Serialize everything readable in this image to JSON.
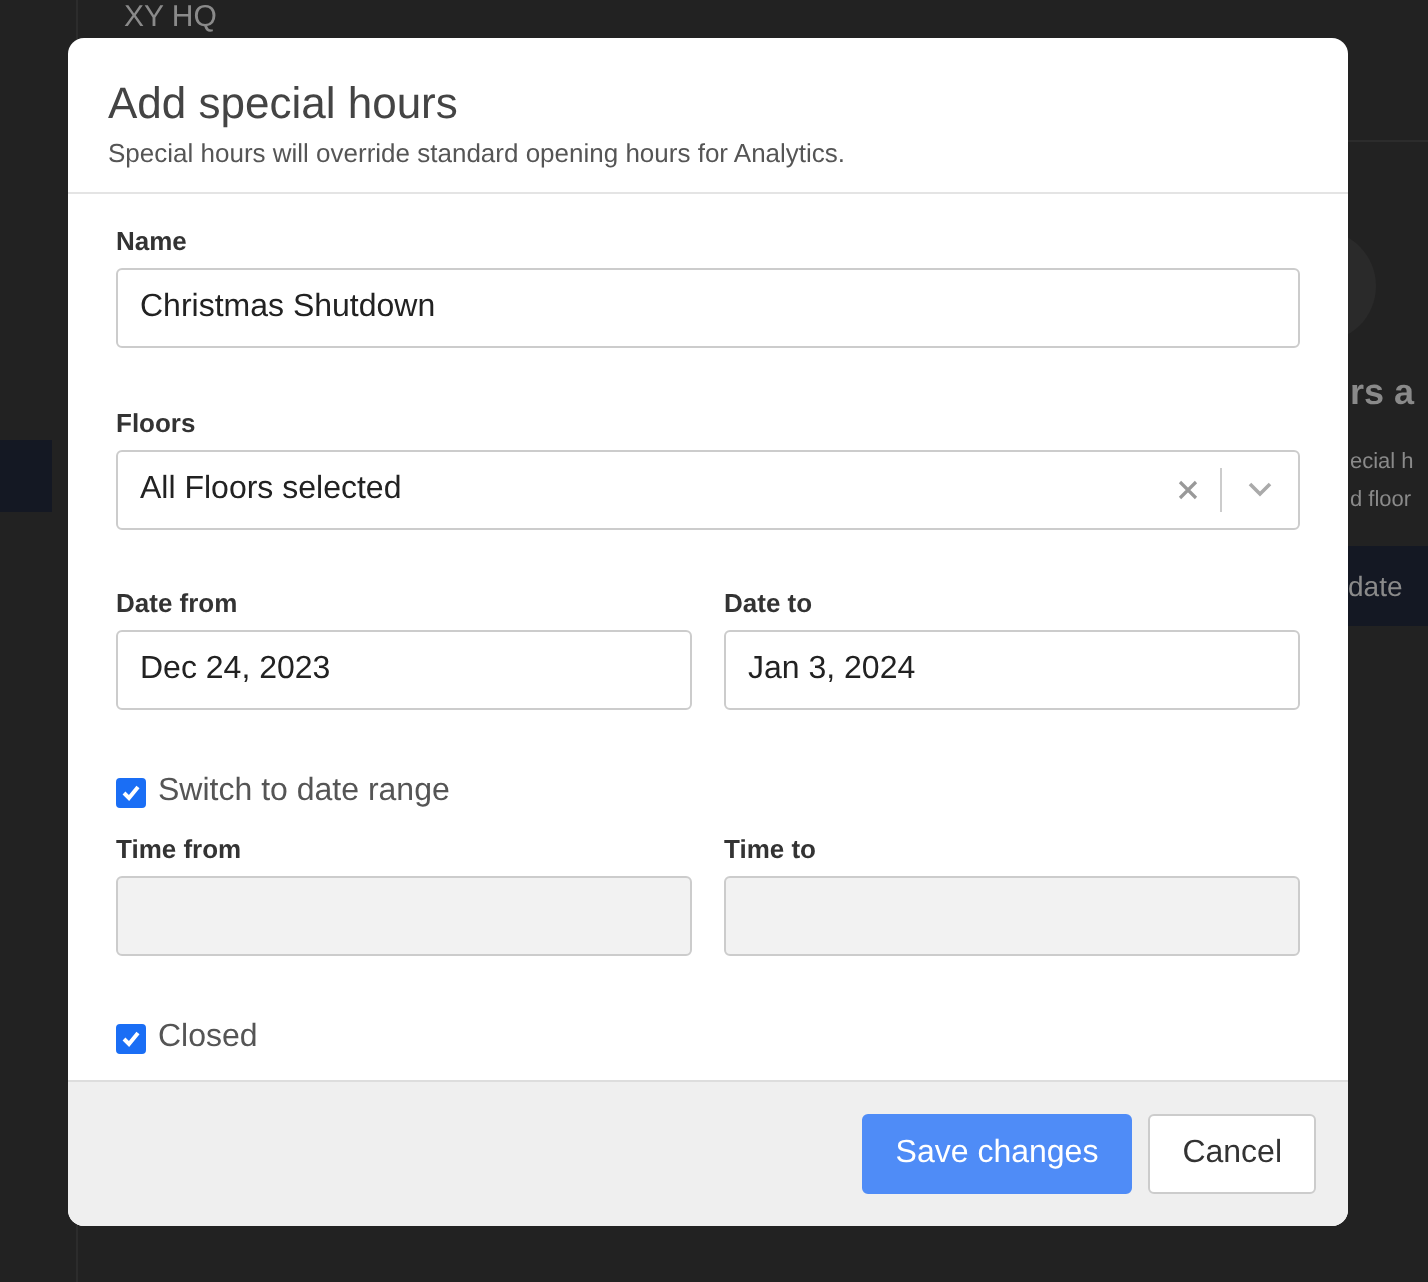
{
  "background": {
    "header": "XY HQ",
    "heading": "rs a",
    "text_lines": [
      "ecial h",
      "d floor"
    ],
    "button": "date"
  },
  "dialog": {
    "title": "Add special hours",
    "subtitle": "Special hours will override standard opening hours for Analytics.",
    "rows": [
      {
        "kind": "text",
        "label": "Name",
        "value": "Christmas Shutdown"
      },
      {
        "kind": "select",
        "label": "Floors",
        "value": "All Floors selected"
      },
      {
        "kind": "pair",
        "fields": [
          {
            "label": "Date from",
            "value": "Dec 24, 2023",
            "disabled": false
          },
          {
            "label": "Date to",
            "value": "Jan 3, 2024",
            "disabled": false
          }
        ]
      },
      {
        "kind": "checkbox",
        "label": "Switch to date range",
        "checked": true
      },
      {
        "kind": "pair",
        "fields": [
          {
            "label": "Time from",
            "disabled": true
          },
          {
            "label": "Time to",
            "disabled": true
          }
        ]
      },
      {
        "kind": "checkbox",
        "label": "Closed",
        "checked": true
      }
    ],
    "buttons": [
      {
        "label": "Save changes",
        "kind": "primary"
      },
      {
        "label": "Cancel",
        "kind": "secondary"
      }
    ]
  }
}
